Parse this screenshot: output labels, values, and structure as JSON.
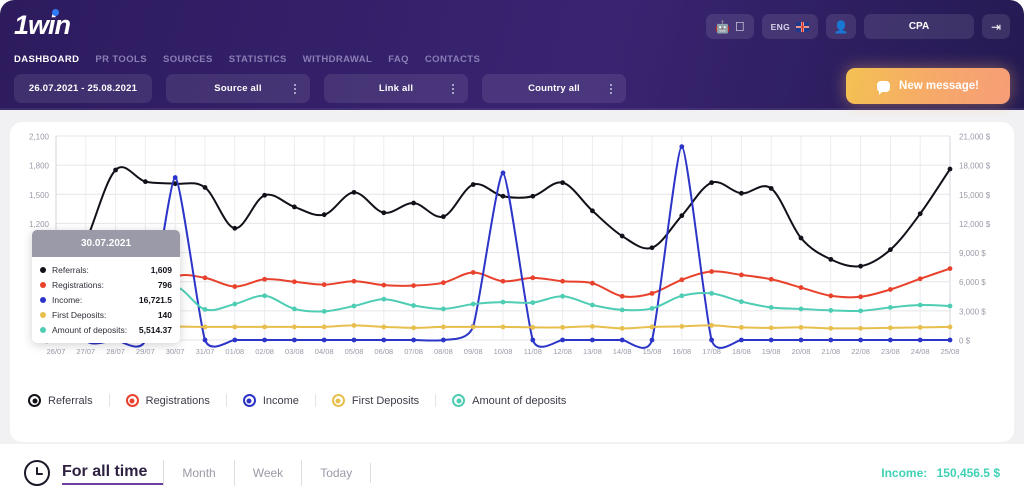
{
  "brand": {
    "logo_one": "1",
    "logo_rest": "win"
  },
  "nav": {
    "items": [
      {
        "label": "DASHBOARD",
        "active": true
      },
      {
        "label": "PR TOOLS",
        "active": false
      },
      {
        "label": "SOURCES",
        "active": false
      },
      {
        "label": "STATISTICS",
        "active": false
      },
      {
        "label": "WITHDRAWAL",
        "active": false
      },
      {
        "label": "FAQ",
        "active": false
      },
      {
        "label": "CONTACTS",
        "active": false
      }
    ]
  },
  "topbar": {
    "android_icon": "android-icon",
    "apple_icon": "apple-icon",
    "lang": "ENG",
    "flag_icon": "uk-flag-icon",
    "user_icon": "user-icon",
    "account": "CPA",
    "logout_icon": "logout-icon",
    "new_message": "New message!",
    "message_icon": "chat-bubble-icon"
  },
  "filters": {
    "date_range": "26.07.2021 - 25.08.2021",
    "source": "Source all",
    "link": "Link all",
    "country": "Country all"
  },
  "tooltip": {
    "date": "30.07.2021",
    "rows": [
      {
        "name": "Referrals:",
        "value": "1,609",
        "color": "#11111a"
      },
      {
        "name": "Registrations:",
        "value": "796",
        "color": "#e8412c"
      },
      {
        "name": "Income:",
        "value": "16,721.5",
        "color": "#2c35c8"
      },
      {
        "name": "First Deposits:",
        "value": "140",
        "color": "#e8bf4d"
      },
      {
        "name": "Amount of deposits:",
        "value": "5,514.37",
        "color": "#4ecdb4"
      }
    ]
  },
  "legend": [
    {
      "label": "Referrals",
      "color": "#11111a"
    },
    {
      "label": "Registrations",
      "color": "#e8412c"
    },
    {
      "label": "Income",
      "color": "#2c35c8"
    },
    {
      "label": "First Deposits",
      "color": "#e8bf4d"
    },
    {
      "label": "Amount of deposits",
      "color": "#4ecdb4"
    }
  ],
  "footer": {
    "clock_icon": "clock-icon",
    "tabs": [
      {
        "label": "For all time",
        "active": true
      },
      {
        "label": "Month",
        "active": false
      },
      {
        "label": "Week",
        "active": false
      },
      {
        "label": "Today",
        "active": false
      }
    ],
    "income_label": "Income:",
    "income_value": "150,456.5 $"
  },
  "chart_data": {
    "type": "line",
    "title": "",
    "xlabel": "",
    "ylabel": "",
    "grid": true,
    "legend_position": "bottom",
    "categories": [
      "26/07",
      "27/07",
      "28/07",
      "29/07",
      "30/07",
      "31/07",
      "01/08",
      "02/08",
      "03/08",
      "04/08",
      "05/08",
      "06/08",
      "07/08",
      "08/08",
      "09/08",
      "10/08",
      "11/08",
      "12/08",
      "13/08",
      "14/08",
      "15/08",
      "16/08",
      "17/08",
      "18/08",
      "19/08",
      "20/08",
      "21/08",
      "22/08",
      "23/08",
      "24/08",
      "25/08"
    ],
    "y_left": {
      "ticks": [
        0,
        300,
        600,
        900,
        1200,
        1500,
        1800,
        2100
      ],
      "tick_labels": [
        "0",
        "300",
        "600",
        "900",
        "1,200",
        "1,500",
        "1,800",
        "2,100"
      ],
      "ylim": [
        0,
        2100
      ]
    },
    "y_right": {
      "ticks": [
        0,
        3000,
        6000,
        9000,
        12000,
        15000,
        18000,
        21000
      ],
      "tick_labels": [
        "0 $",
        "3,000 $",
        "6,000 $",
        "9,000 $",
        "12,000 $",
        "15,000 $",
        "18,000 $",
        "21,000 $"
      ],
      "ylim": [
        0,
        21000
      ]
    },
    "series": [
      {
        "name": "Referrals",
        "color": "#11111a",
        "axis": "left",
        "values": [
          330,
          1010,
          1750,
          1630,
          1609,
          1570,
          1150,
          1490,
          1370,
          1290,
          1520,
          1310,
          1410,
          1270,
          1600,
          1480,
          1480,
          1620,
          1330,
          1070,
          950,
          1280,
          1620,
          1510,
          1560,
          1050,
          830,
          760,
          930,
          1300,
          1760
        ]
      },
      {
        "name": "Registrations",
        "color": "#e8412c",
        "axis": "right",
        "values": [
          2900,
          4700,
          4200,
          4000,
          6500,
          6400,
          5500,
          6250,
          6000,
          5700,
          6050,
          5650,
          5600,
          5900,
          6950,
          6050,
          6400,
          6050,
          5850,
          4500,
          4800,
          6200,
          7050,
          6700,
          6250,
          5400,
          4550,
          4450,
          5200,
          6300,
          7350
        ]
      },
      {
        "name": "Income",
        "color": "#2c35c8",
        "axis": "right",
        "values": [
          9000,
          0,
          0,
          0,
          16721.5,
          0,
          0,
          0,
          0,
          0,
          0,
          0,
          0,
          0,
          1400,
          17200,
          0,
          0,
          0,
          0,
          0,
          19900,
          0,
          0,
          0,
          0,
          0,
          0,
          0,
          0,
          0
        ]
      },
      {
        "name": "First Deposits",
        "color": "#e8bf4d",
        "axis": "left",
        "values": [
          110,
          135,
          160,
          160,
          140,
          135,
          135,
          135,
          135,
          135,
          150,
          135,
          125,
          135,
          135,
          135,
          130,
          130,
          140,
          120,
          135,
          140,
          150,
          130,
          125,
          130,
          120,
          120,
          125,
          130,
          135
        ]
      },
      {
        "name": "Amount of deposits",
        "color": "#4ecdb4",
        "axis": "right",
        "values": [
          4500,
          3450,
          3000,
          4000,
          5514.37,
          3150,
          3700,
          4550,
          3200,
          2950,
          3500,
          4200,
          3550,
          3200,
          3700,
          3900,
          3850,
          4500,
          3600,
          3100,
          3250,
          4550,
          4800,
          3950,
          3350,
          3200,
          3050,
          3000,
          3350,
          3600,
          3500
        ]
      }
    ]
  }
}
